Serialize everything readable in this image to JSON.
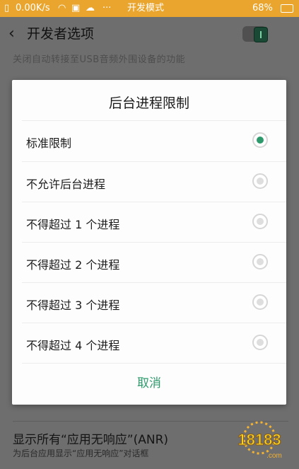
{
  "status_bar": {
    "speed": "0.00K/s",
    "mode": "开发模式",
    "battery": "68%",
    "icons": [
      "sim-icon",
      "wifi-icon",
      "photo-icon",
      "weather-icon",
      "more-icon"
    ]
  },
  "header": {
    "title": "开发者选项",
    "back_icon": "chevron-left-icon",
    "toggle_state": "on"
  },
  "background": {
    "faded_text": "关闭自动转接至USB音频外围设备的功能",
    "faded_text_2": "",
    "anr_title": "显示所有“应用无响应”(ANR)",
    "anr_subtitle": "为后台应用显示“应用无响应”对话框"
  },
  "dialog": {
    "title": "后台进程限制",
    "options": [
      {
        "label": "标准限制",
        "selected": true
      },
      {
        "label": "不允许后台进程",
        "selected": false
      },
      {
        "label": "不得超过 1 个进程",
        "selected": false
      },
      {
        "label": "不得超过 2 个进程",
        "selected": false
      },
      {
        "label": "不得超过 3 个进程",
        "selected": false
      },
      {
        "label": "不得超过 4 个进程",
        "selected": false
      }
    ],
    "cancel_label": "取消"
  },
  "watermark": {
    "text": "18183",
    "sub": ".com"
  },
  "colors": {
    "accent": "#2e9a6c",
    "status_bar": "#e9a52d"
  }
}
